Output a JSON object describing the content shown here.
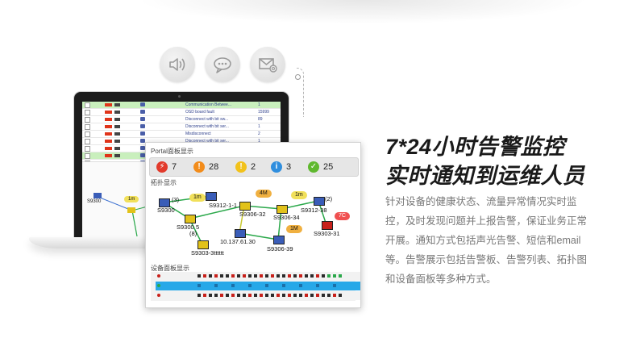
{
  "headline": {
    "line1": "7*24小时告警监控",
    "line2": "实时通知到运维人员"
  },
  "description": "针对设备的健康状态、流量异常情况实时监控，及时发现问题并上报告警，保证业务正常开展。通知方式包括声光告警、短信和email等。告警展示包括告警板、告警列表、拓扑图和设备面板等多种方式。",
  "notify_icons": [
    {
      "name": "speaker-icon"
    },
    {
      "name": "chat-bubble-icon"
    },
    {
      "name": "mail-icon"
    }
  ],
  "alarm_list": [
    {
      "desc": "Communication Betwee...",
      "count": "1",
      "highlight": true
    },
    {
      "desc": "OSD board fault",
      "count": "15999",
      "highlight": false
    },
    {
      "desc": "Disconnect with bit sw...",
      "count": "89",
      "highlight": false
    },
    {
      "desc": "Disconnect with bit ser...",
      "count": "1",
      "highlight": false
    },
    {
      "desc": "Misdisconnect",
      "count": "2",
      "highlight": false
    },
    {
      "desc": "Disconnect with bit ser...",
      "count": "1",
      "highlight": false
    },
    {
      "desc": "Service net port disconn...",
      "count": "1",
      "highlight": false
    },
    {
      "desc": "Communication Betwee...",
      "count": "1",
      "highlight": true
    },
    {
      "desc": "Disconnect with port direc...",
      "count": "1",
      "highlight": false
    }
  ],
  "laptop_topology": {
    "node_label": "S9300",
    "bubble": "1m"
  },
  "portal": {
    "title": "Portal面板显示",
    "counts": [
      {
        "icon": "lightning-icon",
        "glyph": "⚡",
        "value": "7",
        "color": "#e23a2b"
      },
      {
        "icon": "exclamation-orange-icon",
        "glyph": "!",
        "value": "28",
        "color": "#f28c1b"
      },
      {
        "icon": "exclamation-yellow-icon",
        "glyph": "!",
        "value": "2",
        "color": "#f2c21b"
      },
      {
        "icon": "info-icon",
        "glyph": "i",
        "value": "3",
        "color": "#2f8ede"
      },
      {
        "icon": "check-icon",
        "glyph": "✓",
        "value": "25",
        "color": "#5fb82e"
      }
    ],
    "topology_title": "拓扑显示",
    "nodes": [
      {
        "id": "s9300",
        "label": "S9300"
      },
      {
        "id": "s9300-6",
        "label": "S9300"
      },
      {
        "id": "s9312-1-1",
        "label": "S9312-1-1"
      },
      {
        "id": "s9306-32",
        "label": "S9306-32"
      },
      {
        "id": "s9306-34",
        "label": "S9306-34"
      },
      {
        "id": "s9312-38",
        "label": "S9312-38"
      },
      {
        "id": "s9303-31",
        "label": "S9303-31"
      },
      {
        "id": "ip-node",
        "label": "10.137.61.30"
      },
      {
        "id": "s9306-39",
        "label": "S9306-39"
      },
      {
        "id": "s9303-3",
        "label": "S9303-3tttttt"
      }
    ],
    "link_labels": [
      "(3)",
      "(8)",
      "5",
      "(2)"
    ],
    "bubbles": [
      "1m",
      "4M",
      "1m",
      "1M",
      "7C"
    ],
    "panel_title": "设备面板显示"
  }
}
